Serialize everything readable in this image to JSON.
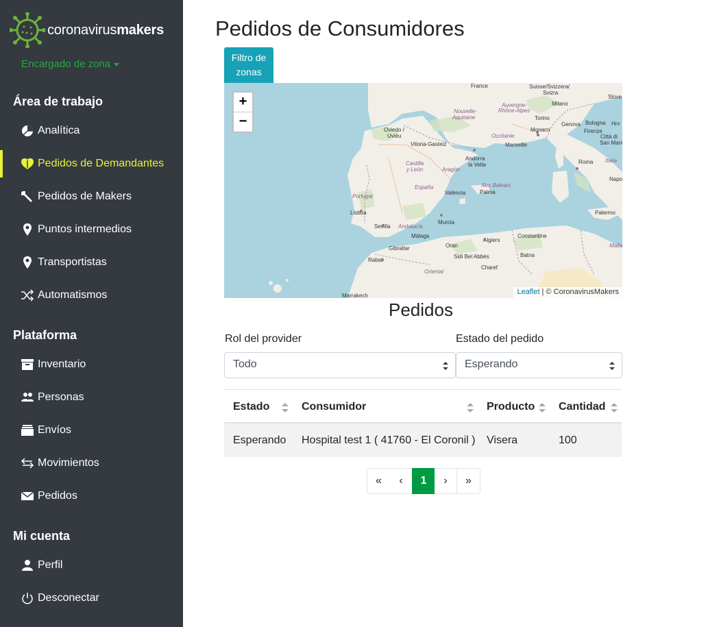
{
  "brand": {
    "name_light": "coronavirus",
    "name_bold": "makers"
  },
  "role": {
    "label": "Encargado de zona"
  },
  "sidebar": {
    "workspace": {
      "title": "Área de trabajo",
      "items": [
        {
          "label": "Analítica",
          "icon": "pie-chart-icon"
        },
        {
          "label": "Pedidos de Demandantes",
          "icon": "heart-shield-icon",
          "active": true
        },
        {
          "label": "Pedidos de Makers",
          "icon": "wrench-icon"
        },
        {
          "label": "Puntos intermedios",
          "icon": "map-pin-icon"
        },
        {
          "label": "Transportistas",
          "icon": "map-pin-icon"
        },
        {
          "label": "Automatismos",
          "icon": "shuffle-icon"
        }
      ]
    },
    "platform": {
      "title": "Plataforma",
      "items": [
        {
          "label": "Inventario",
          "icon": "archive-icon"
        },
        {
          "label": "Personas",
          "icon": "people-icon"
        },
        {
          "label": "Envíos",
          "icon": "stack-icon"
        },
        {
          "label": "Movimientos",
          "icon": "arrows-swap-icon"
        },
        {
          "label": "Pedidos",
          "icon": "envelope-icon"
        }
      ]
    },
    "account": {
      "title": "Mi cuenta",
      "items": [
        {
          "label": "Perfil",
          "icon": "person-icon"
        },
        {
          "label": "Desconectar",
          "icon": "power-icon"
        }
      ]
    }
  },
  "page": {
    "title": "Pedidos de Consumidores"
  },
  "filter_button": {
    "line1": "Filtro de",
    "line2": "zonas"
  },
  "map": {
    "zoom_in": "+",
    "zoom_out": "−",
    "attribution_link": "Leaflet",
    "attribution_text": " | © CoronavirusMakers",
    "labels": {
      "france": "France",
      "suisse": "Suisse/Svizzera/",
      "svizra": "Svizra",
      "slove": "Slove",
      "nouvelle": "Nouvelle-",
      "aquitaine": "Aquitaine",
      "auvergne": "Auvergne-",
      "rhone": "Rhône-Alpes",
      "milano": "Milano",
      "torino": "Torino",
      "bologna": "Bologna",
      "hrv": "Hrv",
      "occitanie": "Occitanie",
      "monaco": "Monaco",
      "genova": "Genova",
      "firenze": "Firenze",
      "citta": "Città di",
      "sanmarino": "San Marino",
      "oviedo": "Oviedo /",
      "uvieu": "Uviéu",
      "vitoria": "Vitoria-Gasteiz",
      "andorra": "Andorra",
      "lavella": "la Vella",
      "marseille": "Marseille",
      "italia": "Italia",
      "roma": "Roma",
      "castilla": "Castilla",
      "yleon": "y León",
      "aragon": "Aragón",
      "espana": "España",
      "illes": "Illes Balears",
      "valencia": "València",
      "palma": "Palma",
      "napoli": "Napoli",
      "portugal": "Portugal",
      "lisboa": "Lisboa",
      "sevilla": "Sevilla",
      "andalucia": "Andalucía",
      "murcia": "Murcia",
      "palermo": "Palermo",
      "malaga": "Málaga",
      "gibraltar": "Gibraltar",
      "oran": "Oran",
      "algiers": "Algiers",
      "constantine": "Constantine",
      "malta": "Malta",
      "rabat": "Rabat",
      "sidi": "Sidi Bel Abbès",
      "batna": "Batna",
      "chlef": "Charef",
      "marrakech": "Marrakech",
      "oriental": "Oriental"
    }
  },
  "orders": {
    "title": "Pedidos",
    "filters": {
      "provider_role": {
        "label": "Rol del provider",
        "value": "Todo"
      },
      "order_status": {
        "label": "Estado del pedido",
        "value": "Esperando"
      }
    },
    "columns": [
      "Estado",
      "Consumidor",
      "Producto",
      "Cantidad"
    ],
    "rows": [
      {
        "estado": "Esperando",
        "consumidor": "Hospital test 1 ( 41760 - El Coronil )",
        "producto": "Visera",
        "cantidad": "100"
      }
    ],
    "pagination": {
      "first": "«",
      "prev": "‹",
      "current": "1",
      "next": "›",
      "last": "»"
    }
  },
  "colors": {
    "sidebar_bg": "#343a40",
    "brand_green": "#28a745",
    "active_yellow": "#e7f13b",
    "filter_btn": "#17a2b8",
    "page_active": "#009a44",
    "sea": "#aad3df",
    "land": "#f2efe9"
  }
}
